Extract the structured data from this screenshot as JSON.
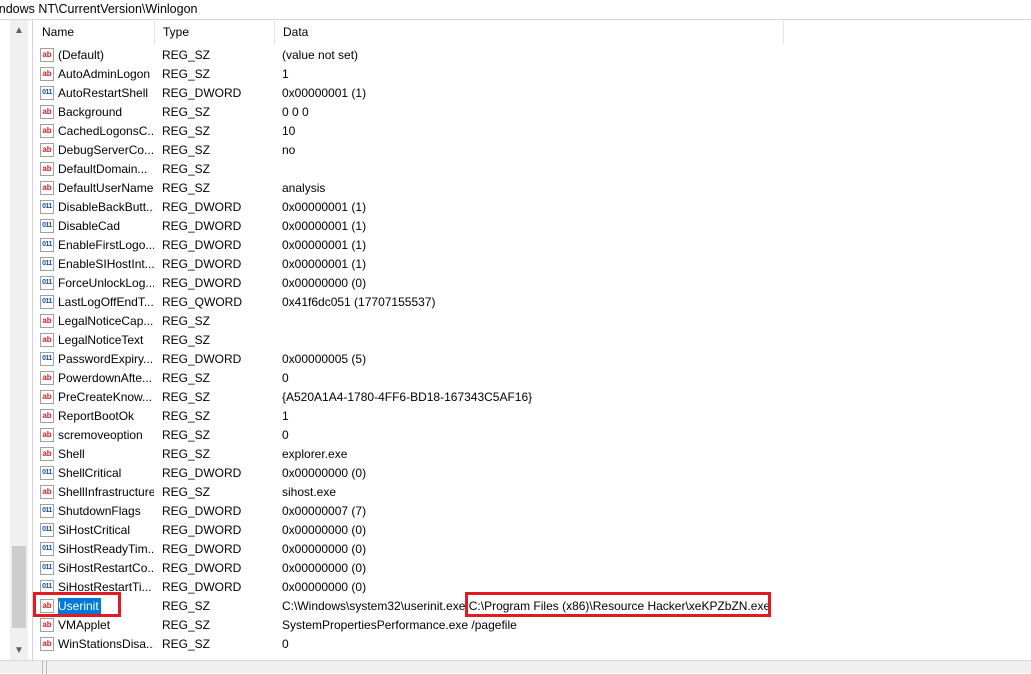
{
  "address": {
    "path": "indows NT\\CurrentVersion\\Winlogon"
  },
  "columns": {
    "name": "Name",
    "type": "Type",
    "data": "Data"
  },
  "scroll": {
    "up_glyph": "▲",
    "down_glyph": "▼"
  },
  "rows": [
    {
      "name": "(Default)",
      "type": "REG_SZ",
      "data": "(value not set)",
      "icon": "string-value-icon"
    },
    {
      "name": "AutoAdminLogon",
      "type": "REG_SZ",
      "data": "1",
      "icon": "string-value-icon"
    },
    {
      "name": "AutoRestartShell",
      "type": "REG_DWORD",
      "data": "0x00000001 (1)",
      "icon": "binary-value-icon"
    },
    {
      "name": "Background",
      "type": "REG_SZ",
      "data": "0 0 0",
      "icon": "string-value-icon"
    },
    {
      "name": "CachedLogonsC...",
      "type": "REG_SZ",
      "data": "10",
      "icon": "string-value-icon"
    },
    {
      "name": "DebugServerCo...",
      "type": "REG_SZ",
      "data": "no",
      "icon": "string-value-icon"
    },
    {
      "name": "DefaultDomain...",
      "type": "REG_SZ",
      "data": "",
      "icon": "string-value-icon"
    },
    {
      "name": "DefaultUserName",
      "type": "REG_SZ",
      "data": "analysis",
      "icon": "string-value-icon"
    },
    {
      "name": "DisableBackButt...",
      "type": "REG_DWORD",
      "data": "0x00000001 (1)",
      "icon": "binary-value-icon"
    },
    {
      "name": "DisableCad",
      "type": "REG_DWORD",
      "data": "0x00000001 (1)",
      "icon": "binary-value-icon"
    },
    {
      "name": "EnableFirstLogo...",
      "type": "REG_DWORD",
      "data": "0x00000001 (1)",
      "icon": "binary-value-icon"
    },
    {
      "name": "EnableSIHostInt...",
      "type": "REG_DWORD",
      "data": "0x00000001 (1)",
      "icon": "binary-value-icon"
    },
    {
      "name": "ForceUnlockLog...",
      "type": "REG_DWORD",
      "data": "0x00000000 (0)",
      "icon": "binary-value-icon"
    },
    {
      "name": "LastLogOffEndT...",
      "type": "REG_QWORD",
      "data": "0x41f6dc051 (17707155537)",
      "icon": "binary-value-icon"
    },
    {
      "name": "LegalNoticeCap...",
      "type": "REG_SZ",
      "data": "",
      "icon": "string-value-icon"
    },
    {
      "name": "LegalNoticeText",
      "type": "REG_SZ",
      "data": "",
      "icon": "string-value-icon"
    },
    {
      "name": "PasswordExpiry...",
      "type": "REG_DWORD",
      "data": "0x00000005 (5)",
      "icon": "binary-value-icon"
    },
    {
      "name": "PowerdownAfte...",
      "type": "REG_SZ",
      "data": "0",
      "icon": "string-value-icon"
    },
    {
      "name": "PreCreateKnow...",
      "type": "REG_SZ",
      "data": "{A520A1A4-1780-4FF6-BD18-167343C5AF16}",
      "icon": "string-value-icon"
    },
    {
      "name": "ReportBootOk",
      "type": "REG_SZ",
      "data": "1",
      "icon": "string-value-icon"
    },
    {
      "name": "scremoveoption",
      "type": "REG_SZ",
      "data": "0",
      "icon": "string-value-icon"
    },
    {
      "name": "Shell",
      "type": "REG_SZ",
      "data": "explorer.exe",
      "icon": "string-value-icon"
    },
    {
      "name": "ShellCritical",
      "type": "REG_DWORD",
      "data": "0x00000000 (0)",
      "icon": "binary-value-icon"
    },
    {
      "name": "ShellInfrastructure",
      "type": "REG_SZ",
      "data": "sihost.exe",
      "icon": "string-value-icon"
    },
    {
      "name": "ShutdownFlags",
      "type": "REG_DWORD",
      "data": "0x00000007 (7)",
      "icon": "binary-value-icon"
    },
    {
      "name": "SiHostCritical",
      "type": "REG_DWORD",
      "data": "0x00000000 (0)",
      "icon": "binary-value-icon"
    },
    {
      "name": "SiHostReadyTim...",
      "type": "REG_DWORD",
      "data": "0x00000000 (0)",
      "icon": "binary-value-icon"
    },
    {
      "name": "SiHostRestartCo...",
      "type": "REG_DWORD",
      "data": "0x00000000 (0)",
      "icon": "binary-value-icon"
    },
    {
      "name": "SiHostRestartTi...",
      "type": "REG_DWORD",
      "data": "0x00000000 (0)",
      "icon": "binary-value-icon"
    },
    {
      "name": "Userinit",
      "type": "REG_SZ",
      "data": "C:\\Windows\\system32\\userinit.exe,C:\\Program Files (x86)\\Resource Hacker\\xeKPZbZN.exe",
      "icon": "string-value-icon",
      "selected": true
    },
    {
      "name": "VMApplet",
      "type": "REG_SZ",
      "data": "SystemPropertiesPerformance.exe /pagefile",
      "icon": "string-value-icon"
    },
    {
      "name": "WinStationsDisa...",
      "type": "REG_SZ",
      "data": "0",
      "icon": "string-value-icon"
    }
  ],
  "colors": {
    "selection": "#0078d7",
    "annotation_box": "#e01b24"
  }
}
